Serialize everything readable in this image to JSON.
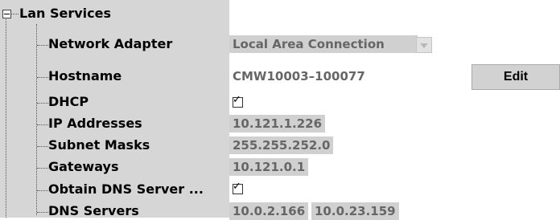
{
  "tree": {
    "root_label": "Lan Services",
    "items": [
      {
        "label": "Network Adapter",
        "value": "Local Area Connection"
      },
      {
        "label": "Hostname",
        "value": "CMW10003–100077"
      },
      {
        "label": "DHCP",
        "checked": true
      },
      {
        "label": "IP Addresses",
        "value": "10.121.1.226"
      },
      {
        "label": "Subnet Masks",
        "value": "255.255.252.0"
      },
      {
        "label": "Gateways",
        "value": "10.121.0.1"
      },
      {
        "label": "Obtain DNS Server ...",
        "checked": true
      },
      {
        "label": "DNS Servers",
        "values": [
          "10.0.2.166",
          "10.0.23.159"
        ]
      }
    ]
  },
  "buttons": {
    "edit_label": "Edit"
  },
  "checkbox_glyph": "✓"
}
